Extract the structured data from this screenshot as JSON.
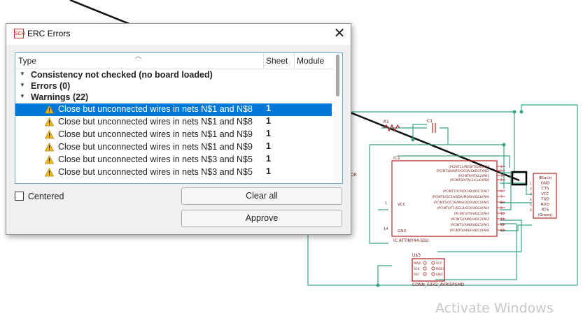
{
  "dialog": {
    "title": "ERC Errors",
    "app_icon_text": "SCH",
    "close_glyph": "✕",
    "columns": {
      "type": "Type",
      "sheet": "Sheet",
      "module": "Module"
    },
    "groups": [
      {
        "expander": "▼",
        "label": "Consistency not checked (no board loaded)"
      },
      {
        "expander": "▼",
        "label": "Errors (0)"
      },
      {
        "expander": "▼",
        "label": "Warnings (22)"
      }
    ],
    "warnings": [
      {
        "text": "Close but unconnected wires in nets N$1 and N$8",
        "sheet": "1",
        "selected": true
      },
      {
        "text": "Close but unconnected wires in nets N$1 and N$8",
        "sheet": "1"
      },
      {
        "text": "Close but unconnected wires in nets N$1 and N$9",
        "sheet": "1"
      },
      {
        "text": "Close but unconnected wires in nets N$1 and N$9",
        "sheet": "1"
      },
      {
        "text": "Close but unconnected wires in nets N$3 and N$5",
        "sheet": "1"
      },
      {
        "text": "Close but unconnected wires in nets N$3 and N$5",
        "sheet": "1"
      }
    ],
    "centered_label": "Centered",
    "centered_checked": false,
    "clear_all_label": "Clear all",
    "approve_label": "Approve",
    "warning_icon": "warning-triangle-icon"
  },
  "schematic": {
    "ic_name": "IC1",
    "ic_value": "IC  ATTINY44-SSU",
    "ic_vcc": "VCC",
    "ic_gnd": "GND",
    "ic_pin1": "1",
    "ic_pin14": "14",
    "ic_pins": [
      {
        "label": "(PCINT11/RESET/DW)PB3",
        "num": "4"
      },
      {
        "label": "(PCINT10/INT0/OC0A/CKOUT)PB2",
        "num": "5"
      },
      {
        "label": "(PCINT9/XTAL2)PB1",
        "num": "3"
      },
      {
        "label": "(PCINT8/XTAL1/CLKI)PB0",
        "num": "2"
      },
      {
        "label": "(PCINT7/ICP/OC0B/ADC7)PA7",
        "num": "6"
      },
      {
        "label": "(PCINT6/OC1A/SDA/MOSI/ADC6)PA6",
        "num": "7"
      },
      {
        "label": "(PCINT5/OC1B/MISO/DO/ADC5)PA5",
        "num": "8"
      },
      {
        "label": "(PCINT4/T1/SCL/USCK/ADC4)PA4",
        "num": "9"
      },
      {
        "label": "(PCINT3/T0/ADC3)PA3",
        "num": "10"
      },
      {
        "label": "(PCINT2/AIN1/ADC2)PA2",
        "num": "11"
      },
      {
        "label": "(PCINT1/AIN0/ADC1)PA1",
        "num": "12"
      },
      {
        "label": "(PCINT0/AREF/ADC0)PA0",
        "num": "13"
      }
    ],
    "ftdi": [
      "(Black)",
      "GND",
      "CTS",
      "VCC",
      "TXD",
      "RXD",
      "RTS",
      "(Green)"
    ],
    "ftdi_nums": [
      "1",
      "2",
      "3",
      "4",
      "5",
      "6"
    ],
    "r_label": "R1",
    "c_label": "C1",
    "conn_name": "U$3",
    "conn_value": "CONN_03X2_AVRISPSMD",
    "conn_pins": [
      "MISO",
      "SCK",
      "RST",
      "VCC",
      "MOSI",
      "GND"
    ],
    "partial_label": "OR"
  },
  "os_watermark": "Activate Windows"
}
